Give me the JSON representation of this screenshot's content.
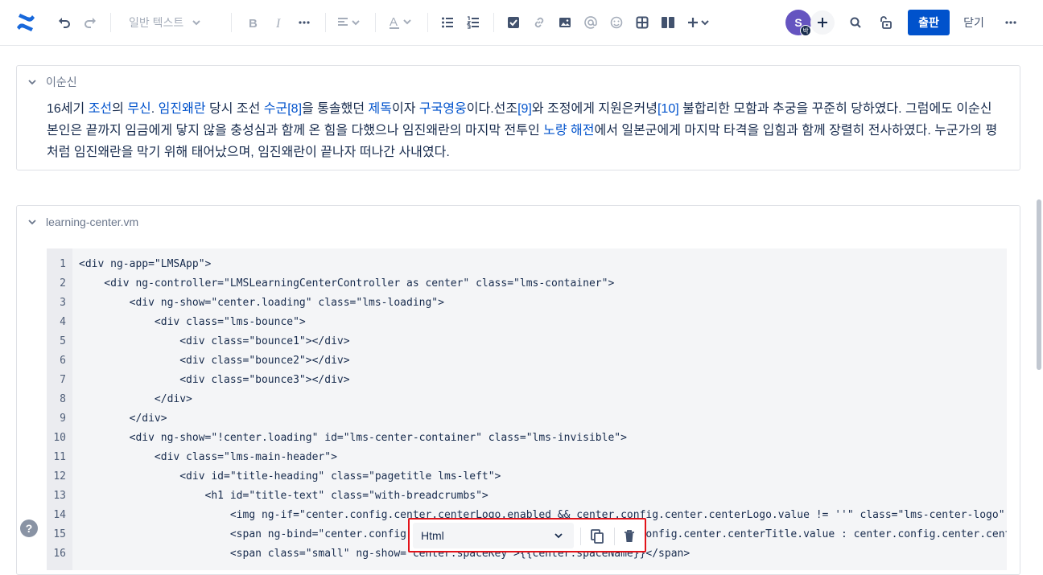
{
  "toolbar": {
    "text_style": "일반 텍스트",
    "avatar_initial": "S",
    "avatar_badge": "박",
    "publish_label": "출판",
    "close_label": "닫기"
  },
  "expand1": {
    "title": "이순신",
    "paragraph": [
      {
        "t": "16세기 ",
        "link": false
      },
      {
        "t": "조선",
        "link": true
      },
      {
        "t": "의 ",
        "link": false
      },
      {
        "t": "무신",
        "link": true
      },
      {
        "t": ". ",
        "link": false
      },
      {
        "t": "임진왜란",
        "link": true
      },
      {
        "t": " 당시 조선 ",
        "link": false
      },
      {
        "t": "수군",
        "link": true
      },
      {
        "t": "[8]",
        "link": true
      },
      {
        "t": "을 통솔했던 ",
        "link": false
      },
      {
        "t": "제독",
        "link": true
      },
      {
        "t": "이자 ",
        "link": false
      },
      {
        "t": "구국영웅",
        "link": true
      },
      {
        "t": "이다.선조",
        "link": false
      },
      {
        "t": "[9]",
        "link": true
      },
      {
        "t": "와 조정에게 지원은커녕",
        "link": false
      },
      {
        "t": "[10]",
        "link": true
      },
      {
        "t": " 불합리한 모함과 추궁을 꾸준히 당하였다. 그럼에도 이순신 본인은 끝까지 임금에게 닿지 않을 충성심과 함께 온 힘을 다했으나 임진왜란의 마지막 전투인 ",
        "link": false
      },
      {
        "t": "노량 해전",
        "link": true
      },
      {
        "t": "에서 일본군에게 마지막 타격을 입힘과 함께 장렬히 전사하였다. 누군가의 평처럼 임진왜란을 막기 위해 태어났으며, 임진왜란이 끝나자 떠나간 사내였다.",
        "link": false
      }
    ]
  },
  "expand2": {
    "title": "learning-center.vm",
    "code_lines": [
      "<div ng-app=\"LMSApp\">",
      "    <div ng-controller=\"LMSLearningCenterController as center\" class=\"lms-container\">",
      "        <div ng-show=\"center.loading\" class=\"lms-loading\">",
      "            <div class=\"lms-bounce\">",
      "                <div class=\"bounce1\"></div>",
      "                <div class=\"bounce2\"></div>",
      "                <div class=\"bounce3\"></div>",
      "            </div>",
      "        </div>",
      "        <div ng-show=\"!center.loading\" id=\"lms-center-container\" class=\"lms-invisible\">",
      "            <div class=\"lms-main-header\">",
      "                <div id=\"title-heading\" class=\"pagetitle lms-left\">",
      "                    <h1 id=\"title-text\" class=\"with-breadcrumbs\">",
      "                        <img ng-if=\"center.config.center.centerLogo.enabled && center.config.center.centerLogo.value != ''\" class=\"lms-center-logo\" ng",
      "                        <span ng-bind=\"center.config.center.centerTitle.enabled ? center.config.center.centerTitle.value : center.config.center.center",
      "                        <span class=\"small\" ng-show=\"center.spaceKey\">{{center.spaceName}}</span>"
    ]
  },
  "code_toolbar": {
    "language": "Html"
  },
  "help_label": "?"
}
